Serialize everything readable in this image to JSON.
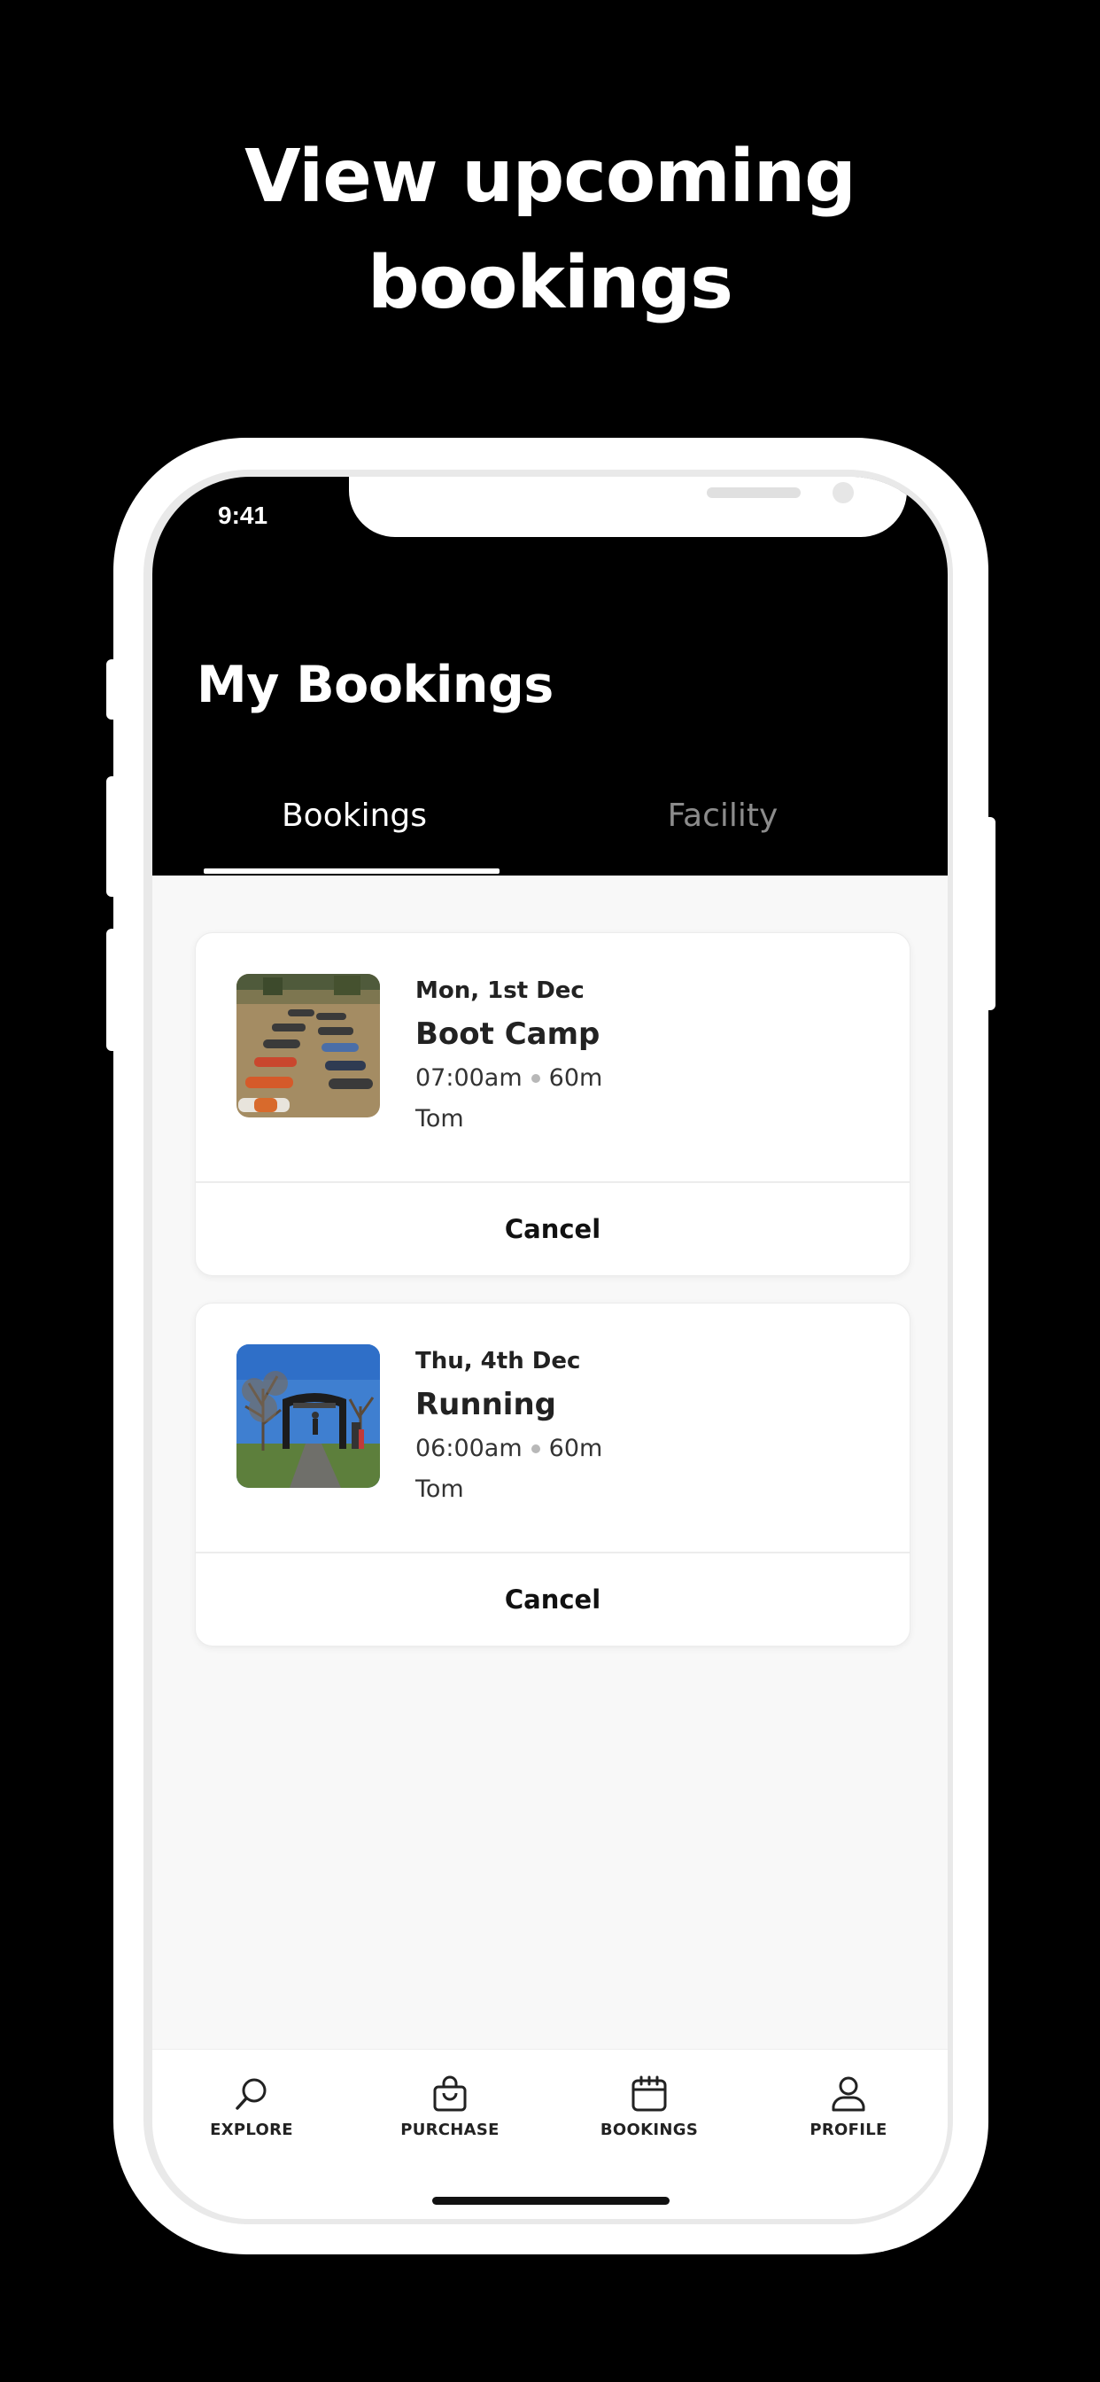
{
  "headline": {
    "line1": "View upcoming",
    "line2": "bookings"
  },
  "status_bar": {
    "time": "9:41",
    "icons": [
      "cellular-signal-icon",
      "wifi-icon",
      "battery-icon"
    ]
  },
  "header": {
    "title": "My Bookings",
    "tabs": [
      {
        "label": "Bookings",
        "active": true
      },
      {
        "label": "Facility",
        "active": false
      }
    ]
  },
  "bookings": [
    {
      "date": "Mon, 1st Dec",
      "title": "Boot Camp",
      "time": "07:00am",
      "duration": "60m",
      "coach": "Tom",
      "image": "boot-camp-photo",
      "cancel_label": "Cancel"
    },
    {
      "date": "Thu, 4th Dec",
      "title": "Running",
      "time": "06:00am",
      "duration": "60m",
      "coach": "Tom",
      "image": "running-photo",
      "cancel_label": "Cancel"
    }
  ],
  "tabbar": {
    "items": [
      {
        "label": "EXPLORE",
        "icon": "search-icon"
      },
      {
        "label": "PURCHASE",
        "icon": "shopping-bag-icon"
      },
      {
        "label": "BOOKINGS",
        "icon": "calendar-icon"
      },
      {
        "label": "PROFILE",
        "icon": "user-icon"
      }
    ]
  },
  "colors": {
    "background": "#000000",
    "screen_background": "#f8f8f8",
    "card": "#ffffff",
    "inactive_tab": "#8c8c8c"
  }
}
